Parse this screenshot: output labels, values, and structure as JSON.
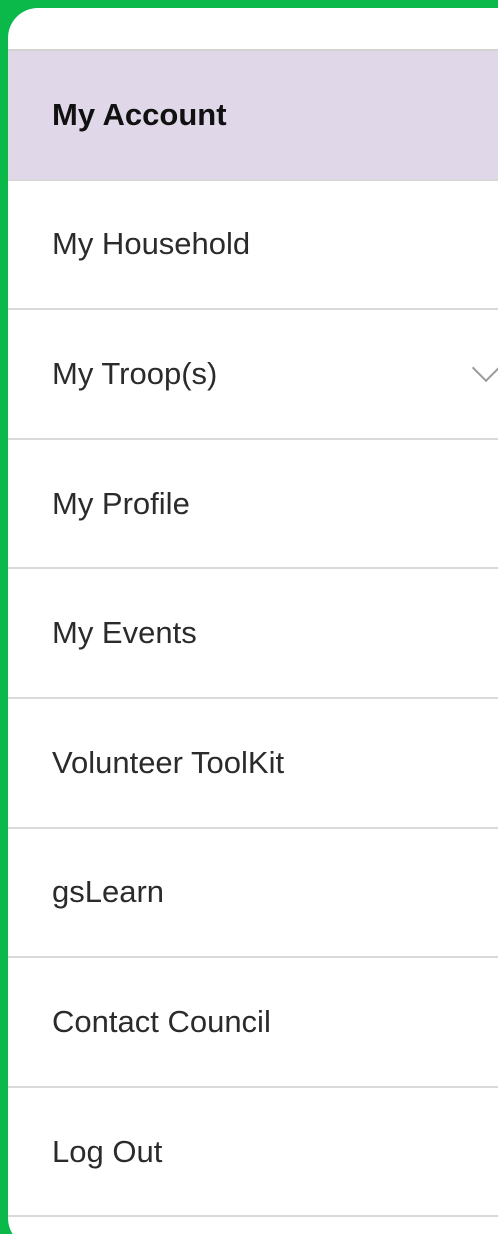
{
  "menu": {
    "items": [
      {
        "label": "My Account",
        "active": true
      },
      {
        "label": "My Household"
      },
      {
        "label": "My Troop(s)",
        "icon": "chevron-down-icon"
      },
      {
        "label": "My Profile"
      },
      {
        "label": "My Events"
      },
      {
        "label": "Volunteer ToolKit"
      },
      {
        "label": "gsLearn"
      },
      {
        "label": "Contact Council"
      },
      {
        "label": "Log Out"
      }
    ]
  },
  "colors": {
    "frame_green": "#0bb84a",
    "active_background": "#e0d8e8",
    "text": "#2b2b2b",
    "divider": "#d9d9d9"
  }
}
